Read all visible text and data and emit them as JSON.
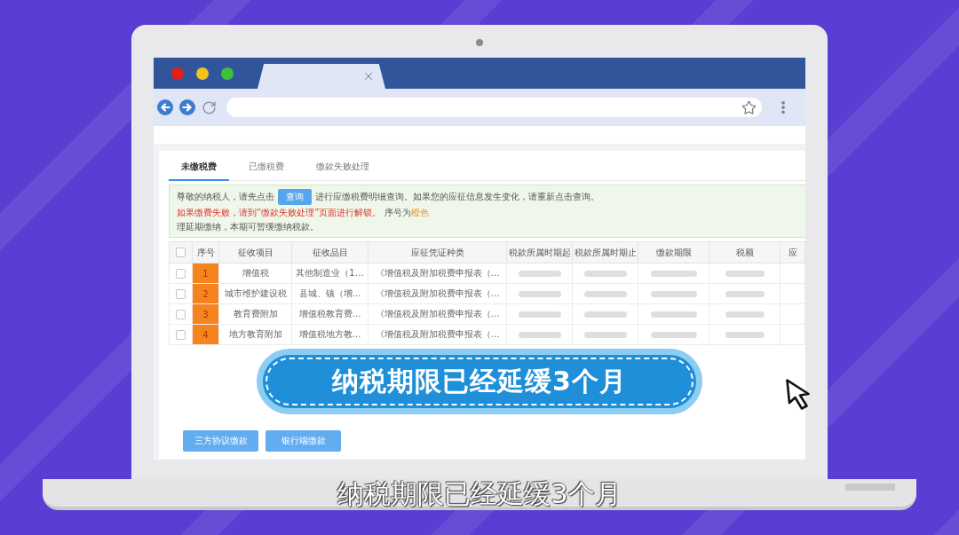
{
  "tabs": [
    {
      "label": "未缴税费",
      "selected": true
    },
    {
      "label": "已缴税费",
      "selected": false
    },
    {
      "label": "缴款失败处理",
      "selected": false
    }
  ],
  "notice": {
    "lead": "尊敬的纳税人，请先点击",
    "button": "查询",
    "segments": [
      {
        "runs": [
          {
            "text": "进行应缴税费明细查询。如果您的应征信息发生变化，请重新点击查询。",
            "warning": false,
            "highlighted": false
          }
        ]
      },
      {
        "runs": [
          {
            "text": "如果缴费失败，请到“缴款失败处理”页面进行解锁。",
            "warning": true,
            "highlighted": false
          }
        ]
      },
      {
        "runs": [
          {
            "text": "序号为",
            "warning": false,
            "highlighted": false
          },
          {
            "text": "橙色",
            "warning": false,
            "highlighted": true
          }
        ]
      }
    ],
    "line_2": "理延期缴纳，本期可暂缓缴纳税款。"
  },
  "table": {
    "select_all": {
      "checked": false
    },
    "columns": [
      {
        "label": "序号",
        "kind": "index"
      },
      {
        "label": "征收项目",
        "kind": "text"
      },
      {
        "label": "征收品目",
        "kind": "text"
      },
      {
        "label": "应征凭证种类",
        "kind": "text"
      },
      {
        "label": "税款所属时期起",
        "kind": "blurred"
      },
      {
        "label": "税款所属时期止",
        "kind": "blurred"
      },
      {
        "label": "缴款期限",
        "kind": "blurred"
      },
      {
        "label": "税额",
        "kind": "blurred"
      },
      {
        "label": "应",
        "kind": "empty"
      }
    ],
    "rows": [
      {
        "checked": false,
        "flagged": true,
        "cells": [
          "1",
          "增值税",
          "其他制造业（1…",
          "《增值税及附加税费申报表（…"
        ]
      },
      {
        "checked": false,
        "flagged": true,
        "cells": [
          "2",
          "城市维护建设税",
          "县城、镇（增…",
          "《增值税及附加税费申报表（…"
        ]
      },
      {
        "checked": false,
        "flagged": true,
        "cells": [
          "3",
          "教育费附加",
          "增值税教育费…",
          "《增值税及附加税费申报表（…"
        ]
      },
      {
        "checked": false,
        "flagged": true,
        "cells": [
          "4",
          "地方教育附加",
          "增值税地方教…",
          "《增值税及附加税费申报表（…"
        ]
      }
    ]
  },
  "actions": [
    {
      "label": "三方协议缴款"
    },
    {
      "label": "银行端缴款"
    }
  ],
  "banner": {
    "text": "纳税期限已经延缓3个月"
  },
  "subtitle": "纳税期限已经延缓3个月"
}
